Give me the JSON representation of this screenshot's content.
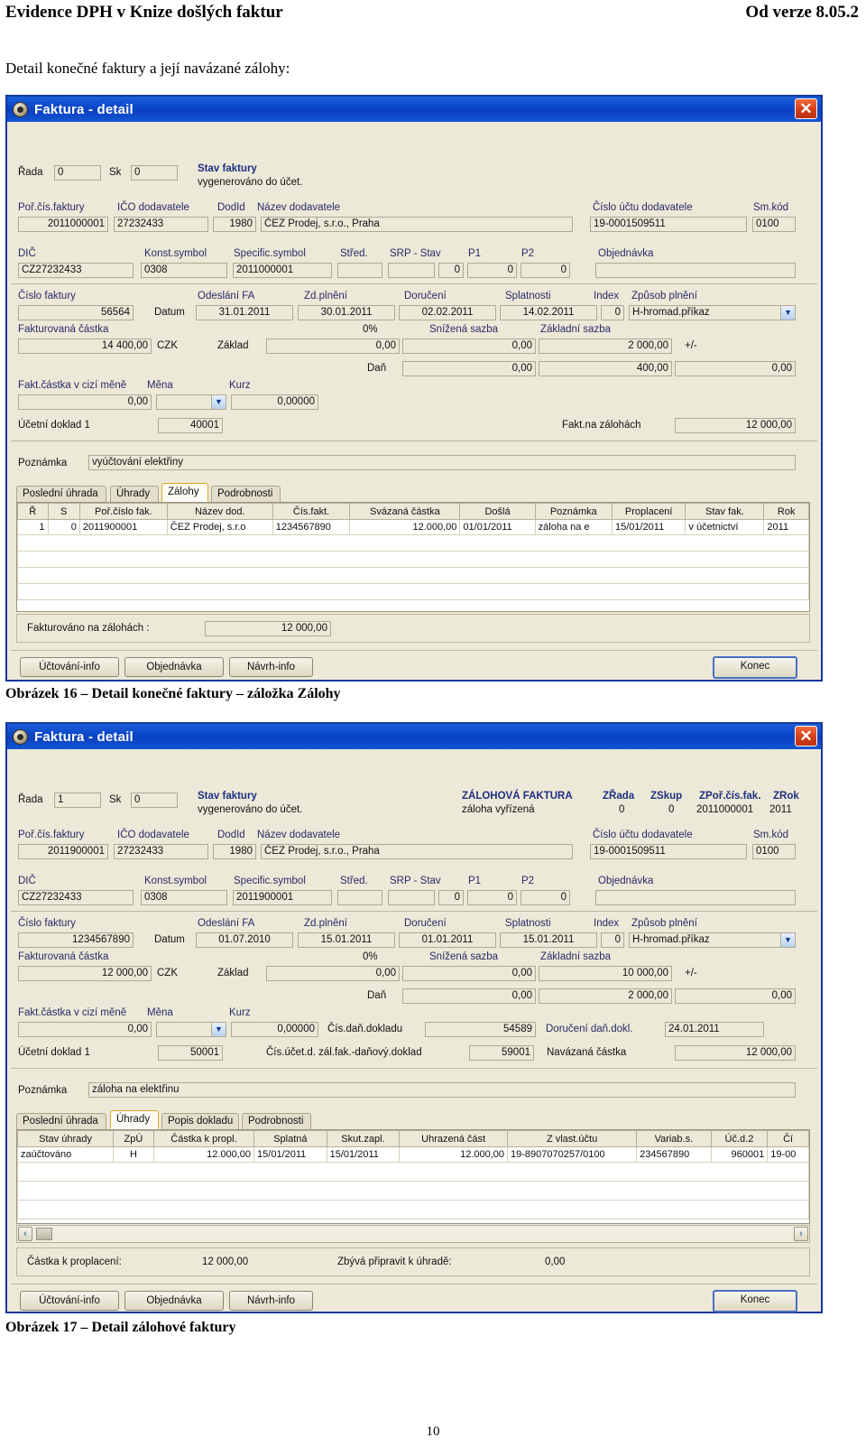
{
  "page": {
    "header_left": "Evidence DPH v Knize došlých faktur",
    "header_right": "Od verze 8.05.2",
    "intro": "Detail konečné faktury a její navázané zálohy:",
    "caption1": "Obrázek 16 – Detail konečné faktury – záložka Zálohy",
    "caption2": "Obrázek 17 – Detail zálohové faktury",
    "page_number": "10"
  },
  "common": {
    "window_title": "Faktura - detail",
    "close_glyph": "✕",
    "labels": {
      "rada": "Řada",
      "sk": "Sk",
      "stav_faktury": "Stav faktury",
      "por_cis_faktury": "Poř.čís.faktury",
      "ico_dodavatele": "IČO dodavatele",
      "dodid": "DodId",
      "nazev_dodavatele": "Název dodavatele",
      "cislo_uctu_dodavatele": "Číslo účtu  dodavatele",
      "sm_kod": "Sm.kód",
      "dic": "DIČ",
      "konst_symbol": "Konst.symbol",
      "specific_symbol": "Specific.symbol",
      "stred": "Střed.",
      "srp_stav": "SRP -  Stav",
      "p1": "P1",
      "p2": "P2",
      "objednavka": "Objednávka",
      "cislo_faktury": "Číslo faktury",
      "datum": "Datum",
      "odeslani_fa": "Odeslání FA",
      "zd_plneni": "Zd.plnění",
      "doruceni": "Doručení",
      "splatnosti": "Splatnosti",
      "index": "Index",
      "zpusob_plneni": "Způsob plnění",
      "fakturovana_castka": "Fakturovaná částka",
      "nula_procent": "0%",
      "snizena_sazba": "Snížená sazba",
      "zakladni_sazba": "Základní sazba",
      "czk": "CZK",
      "zaklad": "Základ",
      "plusminus": "+/-",
      "dan": "Daň",
      "fakt_castka_cizi": "Fakt.částka v cizí měně",
      "mena": "Měna",
      "kurz": "Kurz",
      "ucetni_doklad1": "Účetní doklad 1",
      "poznamka": "Poznámka"
    },
    "buttons": {
      "uctovani_info": "Účtování-info",
      "objednavka": "Objednávka",
      "navrh_info": "Návrh-info",
      "konec": "Konec"
    }
  },
  "dialog1": {
    "rada": "0",
    "sk": "0",
    "stav_faktury_value": "vygenerováno do účet.",
    "por_cis_faktury": "2011000001",
    "ico_dodavatele": "27232433",
    "dodid": "1980",
    "nazev_dodavatele": "ČEZ Prodej, s.r.o., Praha",
    "cislo_uctu_dodavatele": "19-0001509511",
    "sm_kod": "0100",
    "dic": "CZ27232433",
    "konst_symbol": "0308",
    "specific_symbol": "2011000001",
    "stred": "",
    "srp": "",
    "stav": "0",
    "p1": "0",
    "p2": "0",
    "objednavka": "",
    "cislo_faktury": "56564",
    "odeslani_fa": "31.01.2011",
    "zd_plneni": "30.01.2011",
    "doruceni": "02.02.2011",
    "splatnosti": "14.02.2011",
    "index": "0",
    "zpusob_plneni": "H-hromad.příkaz",
    "fakturovana_castka": "14 400,00",
    "zaklad_0": "0,00",
    "zaklad_snizena": "0,00",
    "zaklad_zakladni": "2 000,00",
    "dan_0": "0,00",
    "dan_snizena": "400,00",
    "dan_zakladni": "0,00",
    "fakt_castka_cizi": "0,00",
    "mena": "",
    "kurz": "0,00000",
    "ucetni_doklad1": "40001",
    "fakt_na_zalohach_label": "Fakt.na zálohách",
    "fakt_na_zalohach_value": "12 000,00",
    "poznamka": "vyúčtování elektřiny",
    "tabs": [
      {
        "label": "Poslední úhrada",
        "active": false
      },
      {
        "label": "Úhrady",
        "active": false
      },
      {
        "label": "Zálohy",
        "active": true
      },
      {
        "label": "Podrobnosti",
        "active": false
      }
    ],
    "grid": {
      "columns": [
        "Ř",
        "S",
        "Poř.číslo fak.",
        "Název dod.",
        "Čís.fakt.",
        "Svázaná částka",
        "Došlá",
        "Poznámka",
        "Proplacení",
        "Stav fak.",
        "Rok"
      ],
      "rows": [
        [
          "1",
          "0",
          "2011900001",
          "ČEZ Prodej, s.r.o",
          "1234567890",
          "12.000,00",
          "01/01/2011",
          "záloha na e",
          "15/01/2011",
          "v účetnictví",
          "2011"
        ]
      ]
    },
    "footer_label": "Fakturováno na zálohách :",
    "footer_value": "12 000,00"
  },
  "dialog2": {
    "rada": "1",
    "sk": "0",
    "stav_faktury_value": "vygenerováno do účet.",
    "zalohova_faktura_label": "ZÁLOHOVÁ FAKTURA",
    "zrada_label": "ZŘada",
    "zskup_label": "ZSkup",
    "zpor_cis_fak_label": "ZPoř.čís.fak.",
    "zrok_label": "ZRok",
    "zalohova_faktura_value": "záloha vyřízená",
    "zrada": "0",
    "zskup": "0",
    "zpor_cis_fak": "2011000001",
    "zrok": "2011",
    "por_cis_faktury": "2011900001",
    "ico_dodavatele": "27232433",
    "dodid": "1980",
    "nazev_dodavatele": "ČEZ Prodej, s.r.o., Praha",
    "cislo_uctu_dodavatele": "19-0001509511",
    "sm_kod": "0100",
    "dic": "CZ27232433",
    "konst_symbol": "0308",
    "specific_symbol": "2011900001",
    "stred": "",
    "srp": "",
    "stav": "0",
    "p1": "0",
    "p2": "0",
    "objednavka": "",
    "cislo_faktury": "1234567890",
    "odeslani_fa": "01.07.2010",
    "zd_plneni": "15.01.2011",
    "doruceni": "01.01.2011",
    "splatnosti": "15.01.2011",
    "index": "0",
    "zpusob_plneni": "H-hromad.příkaz",
    "fakturovana_castka": "12 000,00",
    "zaklad_0": "0,00",
    "zaklad_snizena": "0,00",
    "zaklad_zakladni": "10 000,00",
    "dan_0": "0,00",
    "dan_snizena": "2 000,00",
    "dan_zakladni": "0,00",
    "fakt_castka_cizi": "0,00",
    "mena": "",
    "kurz": "0,00000",
    "cis_dan_dokladu_label": "Čís.daň.dokladu",
    "cis_dan_dokladu": "54589",
    "doruceni_dan_dokl_label": "Doručení daň.dokl.",
    "doruceni_dan_dokl": "24.01.2011",
    "ucetni_doklad1": "50001",
    "cis_ucet_d_label": "Čís.účet.d. zál.fak.-daňový.doklad",
    "cis_ucet_d": "59001",
    "navazana_castka_label": "Navázaná částka",
    "navazana_castka": "12 000,00",
    "poznamka": "záloha na elektřinu",
    "tabs": [
      {
        "label": "Poslední úhrada",
        "active": false
      },
      {
        "label": "Úhrady",
        "active": true
      },
      {
        "label": "Popis dokladu",
        "active": false
      },
      {
        "label": "Podrobnosti",
        "active": false
      }
    ],
    "grid": {
      "columns": [
        "Stav  úhrady",
        "ZpÚ",
        "Částka k propl.",
        "Splatná",
        "Skut.zapl.",
        "Uhrazená část",
        "Z vlast.účtu",
        "Variab.s.",
        "Úč.d.2",
        "Čí"
      ],
      "rows": [
        [
          "zaúčtováno",
          "H",
          "12.000,00",
          "15/01/2011",
          "15/01/2011",
          "12.000,00",
          "19-8907070257/0100",
          "234567890",
          "960001",
          "19-00"
        ]
      ]
    },
    "scroll_left_glyph": "‹",
    "scroll_right_glyph": "›",
    "footer_label1": "Částka k proplacení:",
    "footer_value1": "12 000,00",
    "footer_label2": "Zbývá připravit k úhradě:",
    "footer_value2": "0,00"
  }
}
